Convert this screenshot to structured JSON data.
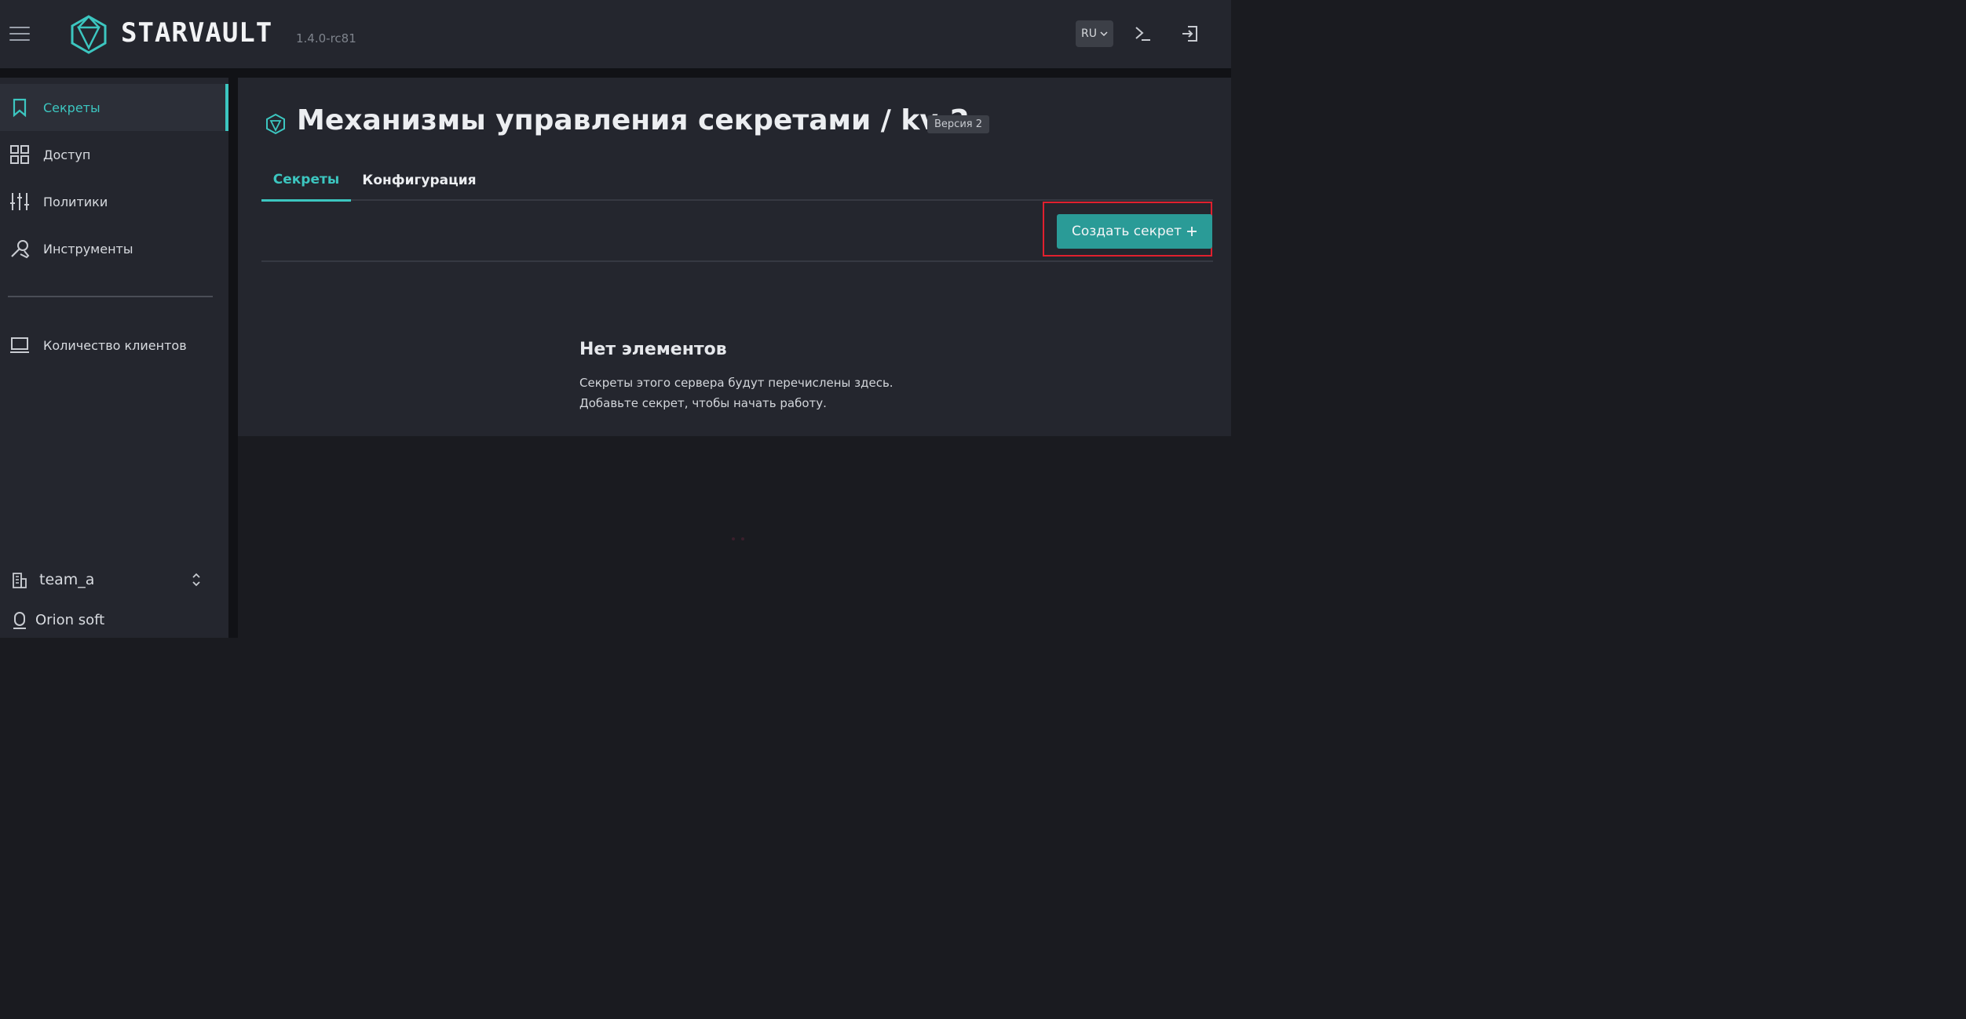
{
  "header": {
    "brand": "STARVAULT",
    "version": "1.4.0-rc81",
    "language": "RU"
  },
  "sidebar": {
    "items": [
      {
        "label": "Секреты",
        "icon": "bookmark-icon",
        "active": true
      },
      {
        "label": "Доступ",
        "icon": "grid-icon",
        "active": false
      },
      {
        "label": "Политики",
        "icon": "sliders-icon",
        "active": false
      },
      {
        "label": "Инструменты",
        "icon": "tools-icon",
        "active": false
      },
      {
        "label": "Количество клиентов",
        "icon": "laptop-icon",
        "active": false
      }
    ],
    "team": "team_a",
    "org": "Orion soft"
  },
  "main": {
    "title": "Механизмы управления секретами / kv-2",
    "version_badge": "Версия 2",
    "tabs": [
      {
        "label": "Секреты",
        "active": true
      },
      {
        "label": "Конфигурация",
        "active": false
      }
    ],
    "create_button": "Создать секрет",
    "empty_title": "Нет элементов",
    "empty_desc": "Секреты этого сервера будут перечислены здесь. Добавьте секрет, чтобы начать работу."
  },
  "colors": {
    "accent": "#3cc6c0",
    "button": "#2a9b97",
    "highlight": "#e0202e"
  }
}
